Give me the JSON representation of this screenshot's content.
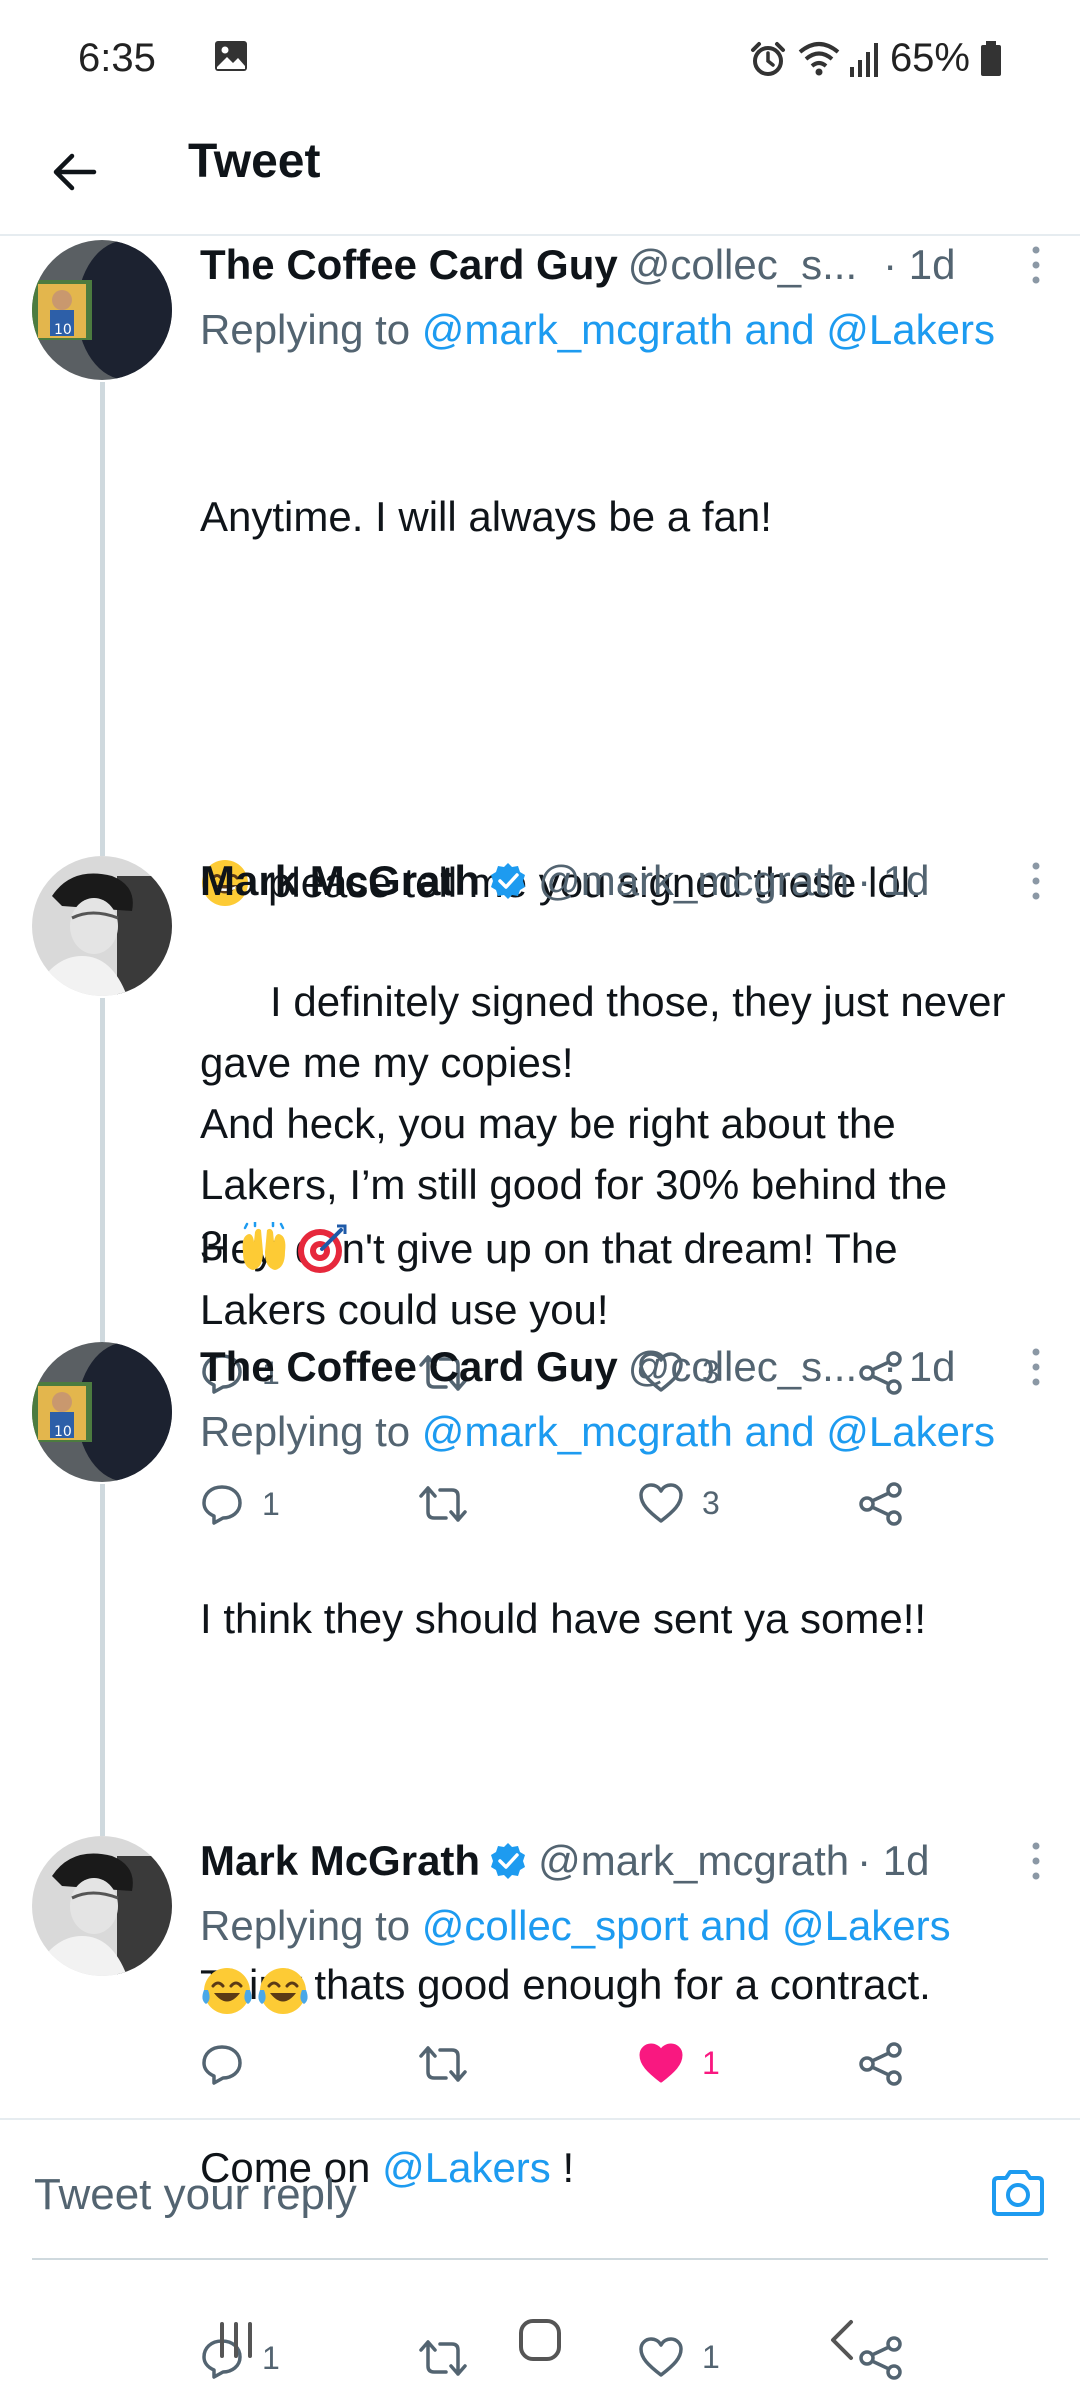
{
  "status": {
    "time": "6:35",
    "battery": "65%"
  },
  "header": {
    "title": "Tweet"
  },
  "tweets": [
    {
      "name": "The Coffee Card Guy",
      "verified": false,
      "handle": "@collec_s...",
      "time": "· 1d",
      "replying_prefix": "Replying to",
      "replying_mentions": "@mark_mcgrath and @Lakers",
      "line1": "Anytime. I will always be a fan!",
      "line2": "please tell me you signed these lol.",
      "line3": "Hey, don't give up on that dream! The\nLakers could use you!",
      "reply_count": "1",
      "like_count": "3"
    },
    {
      "name": "Mark McGrath",
      "verified": true,
      "handle": "@mark_mcgrath",
      "time": "· 1d",
      "body": "I definitely signed those, they just never\ngave me my copies!\nAnd heck, you may be right about the\nLakers, I’m still good for 30% behind the\n3",
      "reply_count": "1",
      "like_count": "3"
    },
    {
      "name": "The Coffee Card Guy",
      "verified": false,
      "handle": "@collec_s...",
      "time": "· 1d",
      "replying_prefix": "Replying to",
      "replying_mentions": "@mark_mcgrath and @Lakers",
      "line1": "I think they should have sent ya some!!",
      "line2": "Think thats good enough for a contract.",
      "line3_prefix": "Come on ",
      "line3_mention": "@Lakers",
      "line3_suffix": " !",
      "reply_count": "1",
      "like_count": "1"
    },
    {
      "name": "Mark McGrath",
      "verified": true,
      "handle": "@mark_mcgrath",
      "time": "· 1d",
      "replying_prefix": "Replying to",
      "replying_mentions": "@collec_sport and @Lakers",
      "like_count": "1",
      "liked": true
    }
  ],
  "reply": {
    "placeholder": "Tweet your reply"
  },
  "colors": {
    "link": "#1d9bf0",
    "like": "#f91880",
    "muted": "#536471"
  }
}
